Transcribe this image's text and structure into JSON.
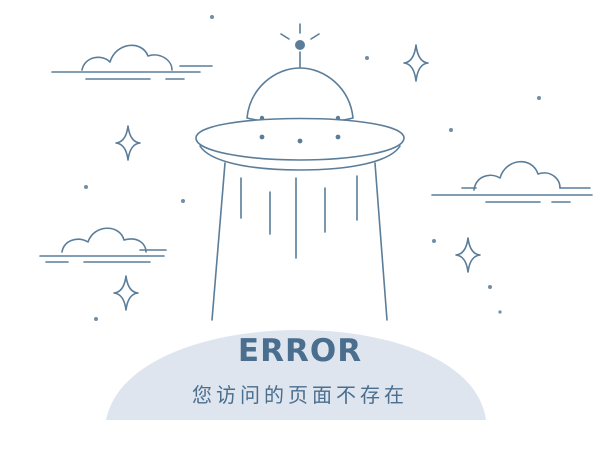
{
  "error_page": {
    "title": "ERROR",
    "message": "您访问的页面不存在"
  },
  "colors": {
    "line": "#5a7d9a",
    "ground": "#dfe5ef",
    "text": "#4a6e8d",
    "dot": "#6f8fa9",
    "background": "#ffffff"
  },
  "icons": {
    "illustration": "ufo-illustration",
    "sparkles": "sparkle-icon",
    "clouds": "cloud-icon"
  }
}
